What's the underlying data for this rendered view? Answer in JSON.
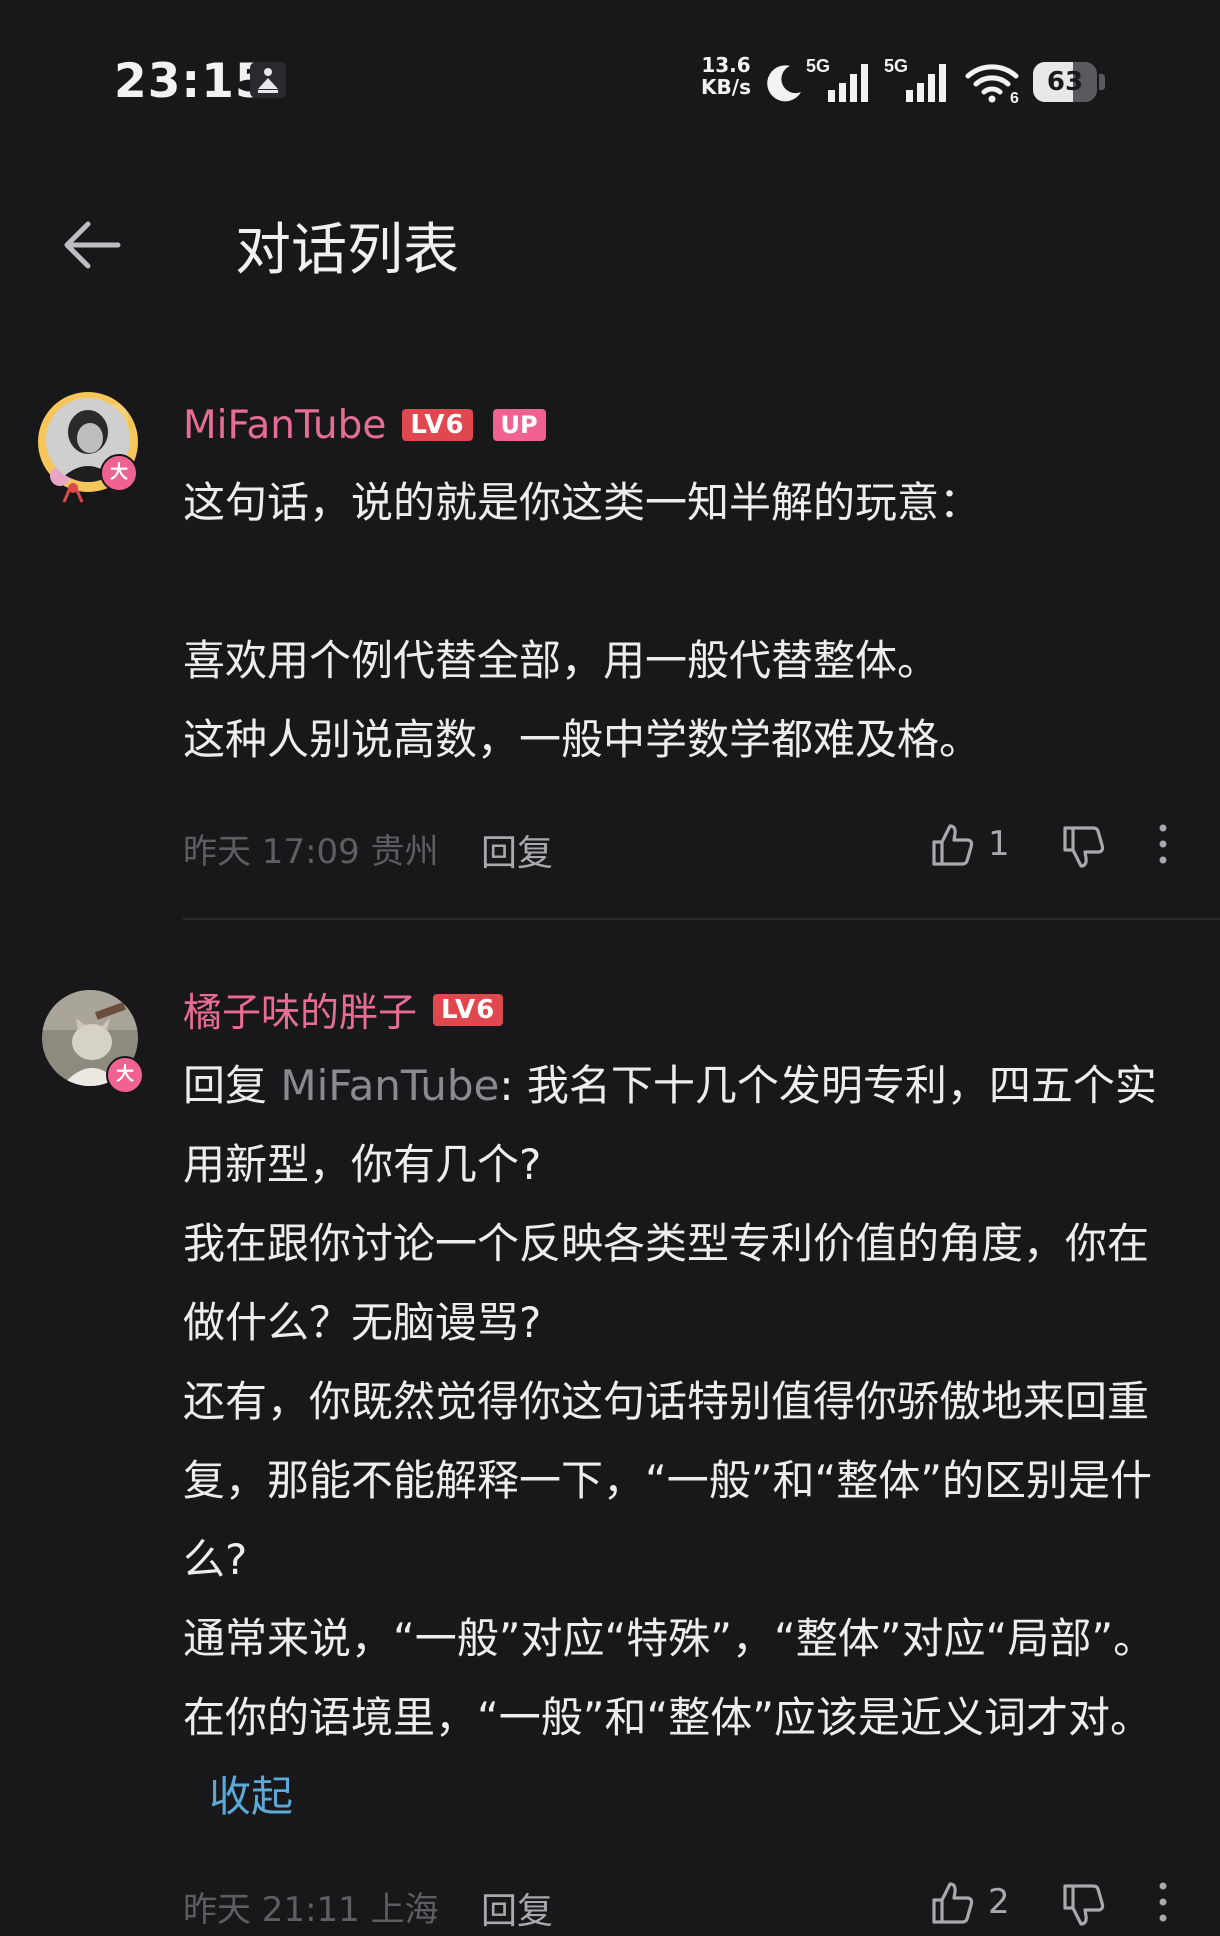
{
  "status_bar": {
    "time": "23:15",
    "net_speed_value": "13.6",
    "net_speed_unit": "KB/s",
    "signal1_label": "5G",
    "signal2_label": "5G",
    "wifi_label": "6",
    "battery": "63",
    "battery_level": 0.63
  },
  "header": {
    "title": "对话列表"
  },
  "comments": [
    {
      "username": "MiFanTube",
      "level": "LV6",
      "up_tag": "UP",
      "avatar_badge": "大",
      "lines": [
        "这句话，说的就是你这类一知半解的玩意：",
        "",
        "喜欢用个例代替全部，用一般代替整体。",
        "这种人别说高数，一般中学数学都难及格。"
      ],
      "date": "昨天 17:09 贵州",
      "reply_label": "回复",
      "likes": "1"
    },
    {
      "username": "橘子味的胖子",
      "level": "LV6",
      "avatar_badge": "大",
      "reply_prefix": "回复 ",
      "reply_target": "MiFanTube",
      "lines": [
        ": 我名下十几个发明专利，四五个实用新型，你有几个?",
        "我在跟你讨论一个反映各类型专利价值的角度，你在做什么？无脑谩骂?",
        "还有，你既然觉得你这句话特别值得你骄傲地来回重复，那能不能解释一下，“一般”和“整体”的区别是什么?",
        "通常来说，“一般”对应“特殊”，“整体”对应“局部”。在你的语境里，“一般”和“整体”应该是近义词才对。"
      ],
      "collapse_label": "收起",
      "date": "昨天 21:11 上海",
      "reply_label": "回复",
      "likes": "2"
    }
  ]
}
